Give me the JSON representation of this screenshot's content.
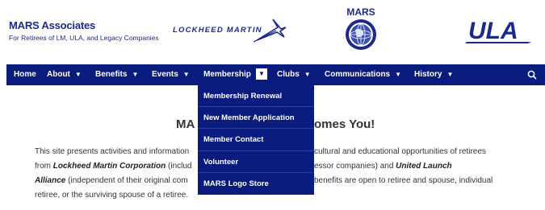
{
  "header": {
    "brand_title": "MARS Associates",
    "brand_subtitle": "For Retirees of LM, ULA, and Legacy Companies",
    "lockheed_logo_text": "LOCKHEED MARTIN",
    "mars_logo_text": "MARS",
    "ula_logo_text": "ULA"
  },
  "nav": {
    "items": [
      {
        "label": "Home",
        "has_chevron": false
      },
      {
        "label": "About",
        "has_chevron": true
      },
      {
        "label": "Benefits",
        "has_chevron": true
      },
      {
        "label": "Events",
        "has_chevron": true
      },
      {
        "label": "Membership",
        "has_chevron": true,
        "active": true
      },
      {
        "label": "Clubs",
        "has_chevron": true
      },
      {
        "label": "Communications",
        "has_chevron": true
      },
      {
        "label": "History",
        "has_chevron": true
      }
    ],
    "search_icon": "search-icon"
  },
  "dropdown": {
    "items": [
      "Membership Renewal",
      "New Member Application",
      "Member Contact",
      "Volunteer",
      "MARS Logo Store"
    ]
  },
  "main": {
    "heading_left": "MA",
    "heading_right": "omes You!",
    "para": {
      "l1_a": "This site presents activities and information",
      "l1_b": "cultural and educational opportunities of retirees",
      "l2_a": "from ",
      "l2_b": "Lockheed Martin Corporation",
      "l2_c": " (includ",
      "l2_d": "essor companies) and ",
      "l2_e": "United Launch",
      "l3_a": "Alliance",
      "l3_b": " (independent of their original com",
      "l3_c": "benefits are open to retiree and spouse, individual",
      "l4_a": "retiree, or the surviving spouse of a retiree."
    }
  },
  "colors": {
    "nav_bg": "#0a1b7e",
    "brand": "#1a2a8c"
  }
}
